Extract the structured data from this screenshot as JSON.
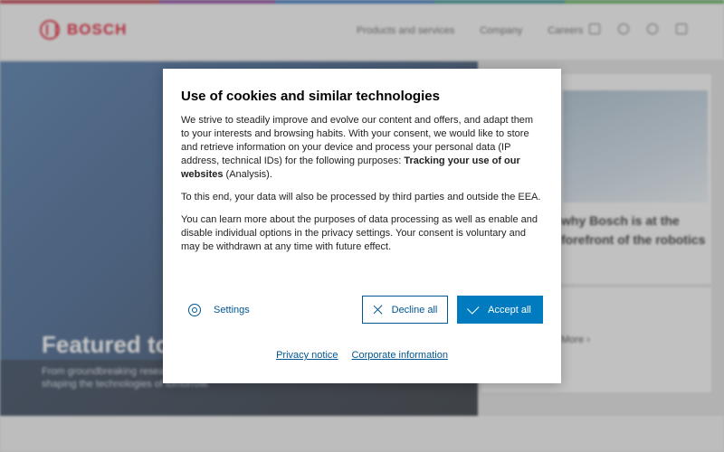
{
  "background": {
    "logo_text": "BOSCH",
    "nav": [
      "Products and services",
      "Company",
      "Careers"
    ],
    "hero_title": "Featured to",
    "hero_sub": "From groundbreaking research to everyday ... means challenging the status quo and shaping the technologies of tomorrow.",
    "side_text": "why Bosch is at the forefront of the robotics",
    "side_link": "More ›"
  },
  "dialog": {
    "title": "Use of cookies and similar technologies",
    "p1_start": "We strive to steadily improve and evolve our content and offers, and adapt them to your interests and browsing habits. With your consent, we would like to store and retrieve information on your device and process your personal data (IP address, technical IDs) for the following purposes: ",
    "p1_bold": "Tracking your use of our websites",
    "p1_end": " (Analysis).",
    "p2": "To this end, your data will also be processed by third parties and outside the EEA.",
    "p3": "You can learn more about the purposes of data processing as well as enable and disable individual options in the privacy settings. Your consent is voluntary and may be withdrawn at any time with future effect.",
    "settings_label": "Settings",
    "decline_label": "Decline all",
    "accept_label": "Accept all",
    "privacy_link": "Privacy notice",
    "corporate_link": "Corporate information"
  },
  "colors": {
    "primary": "#007bc0",
    "link": "#005691",
    "brand_red": "#e0001b"
  },
  "icons": [
    "gear-icon",
    "close-icon",
    "check-icon"
  ]
}
